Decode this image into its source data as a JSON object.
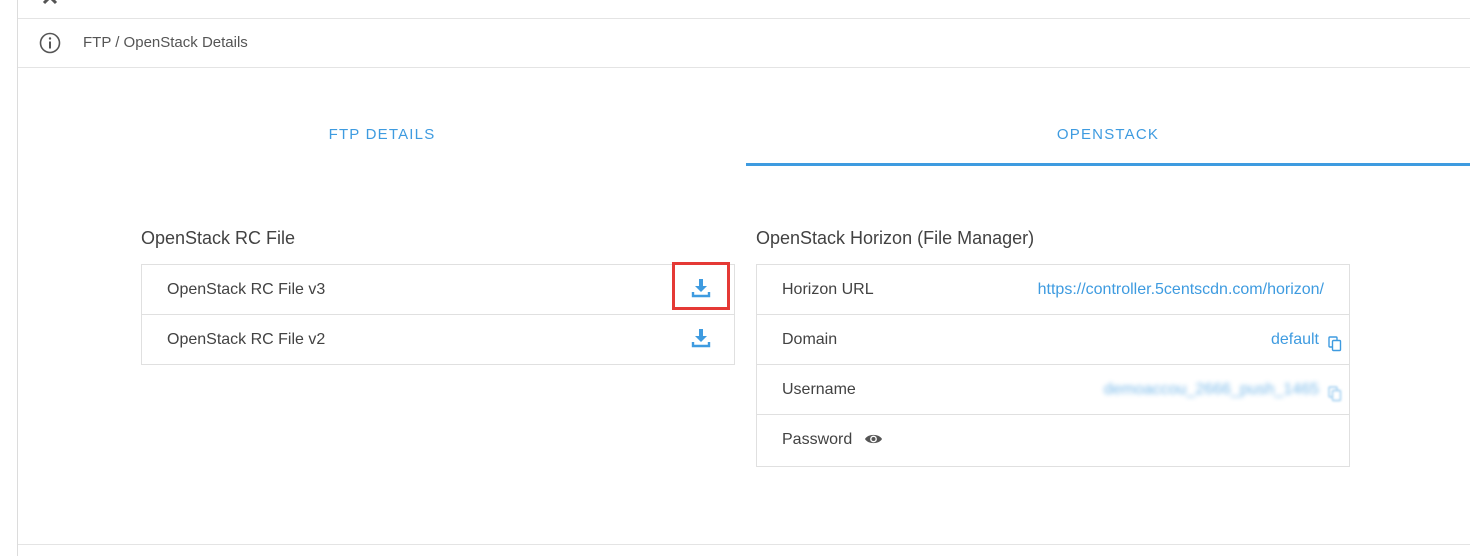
{
  "header": {
    "title": "FTP / OpenStack Details"
  },
  "tabs": [
    {
      "label": "FTP DETAILS",
      "active": false
    },
    {
      "label": "OPENSTACK",
      "active": true
    }
  ],
  "rc_file": {
    "title": "OpenStack RC File",
    "items": [
      {
        "label": "OpenStack RC File v3",
        "icon": "download-icon"
      },
      {
        "label": "OpenStack RC File v2",
        "icon": "download-icon"
      }
    ]
  },
  "horizon": {
    "title": "OpenStack Horizon (File Manager)",
    "rows": [
      {
        "label": "Horizon URL",
        "value": "https://controller.5centscdn.com/horizon/"
      },
      {
        "label": "Domain",
        "value": "default"
      },
      {
        "label": "Username",
        "value": "demoaccou_2666_push_1465"
      },
      {
        "label": "Password",
        "value": ""
      }
    ]
  },
  "colors": {
    "accent": "#3e9be0",
    "highlight": "#e53935",
    "text": "#424242",
    "border": "#e0e0e0"
  }
}
